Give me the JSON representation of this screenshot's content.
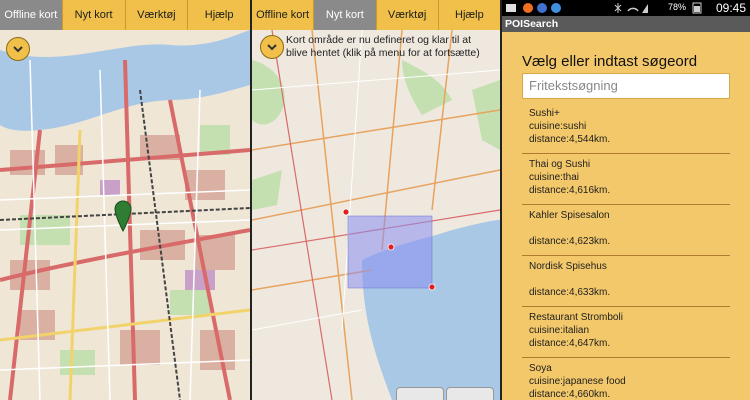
{
  "panel1": {
    "tabs": [
      {
        "label": "Offline kort",
        "active": true
      },
      {
        "label": "Nyt kort",
        "active": false
      },
      {
        "label": "Værktøj",
        "active": false
      },
      {
        "label": "Hjælp",
        "active": false
      }
    ],
    "menu_icon": "chevron-down-icon",
    "marker_icon": "map-pin-icon"
  },
  "panel2": {
    "tabs": [
      {
        "label": "Offline kort",
        "active": false
      },
      {
        "label": "Nyt kort",
        "active": true
      },
      {
        "label": "Værktøj",
        "active": false
      },
      {
        "label": "Hjælp",
        "active": false
      }
    ],
    "menu_icon": "chevron-down-icon",
    "notice": "Kort område er nu defineret og klar til at blive hentet (klik på menu for at fortsætte)"
  },
  "panel3": {
    "status": {
      "battery": "78%",
      "time": "09:45"
    },
    "app_title": "POISearch",
    "heading": "Vælg eller indtast søgeord",
    "search_placeholder": "Fritekstsøgning",
    "results": [
      {
        "name": "Sushi+",
        "cuisine": "cuisine:sushi",
        "distance": "distance:4,544km."
      },
      {
        "name": "Thai og Sushi",
        "cuisine": "cuisine:thai",
        "distance": "distance:4,616km."
      },
      {
        "name": "Kahler Spisesalon",
        "cuisine": "",
        "distance": "distance:4,623km."
      },
      {
        "name": "Nordisk Spisehus",
        "cuisine": "",
        "distance": "distance:4,633km."
      },
      {
        "name": "Restaurant Stromboli",
        "cuisine": "cuisine:italian",
        "distance": "distance:4,647km."
      },
      {
        "name": "Soya",
        "cuisine": "cuisine:japanese food",
        "distance": "distance:4,660km."
      }
    ]
  },
  "colors": {
    "tab_bar": "#f0c04a",
    "tab_active": "#8a8a8a",
    "list_bg": "#f3c86a",
    "selection": "#8a8ef0"
  }
}
